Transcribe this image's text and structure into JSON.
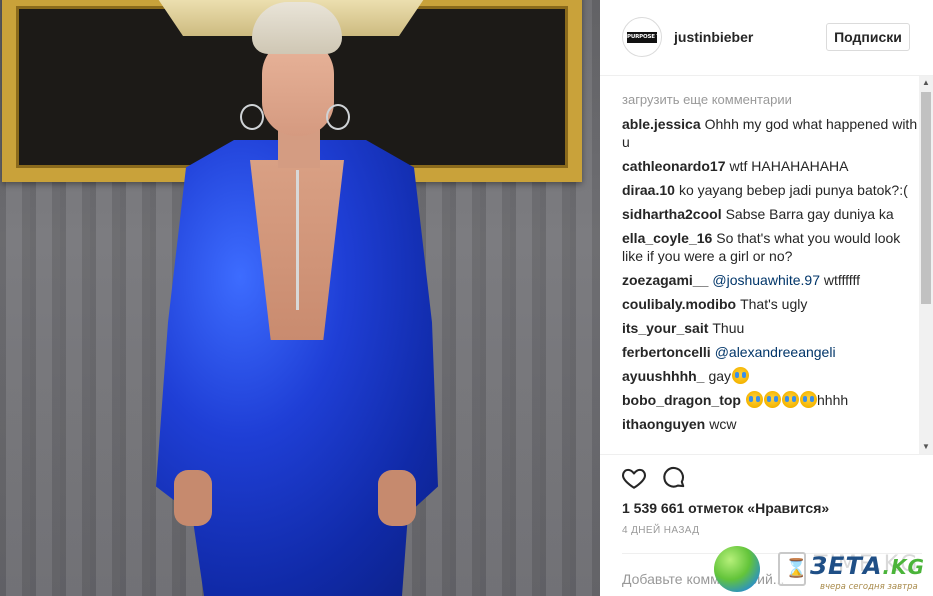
{
  "post": {
    "username": "justinbieber",
    "avatar_logo_text": "PURPOSE TOUR",
    "follow_label": "Подписки"
  },
  "comments": {
    "load_more": "загрузить еще комментарии",
    "items": [
      {
        "author": "able.jessica",
        "text": "Ohhh my god what happened with u"
      },
      {
        "author": "cathleonardo17",
        "text": "wtf HAHAHAHAHA"
      },
      {
        "author": "diraa.10",
        "text": "ko yayang bebep jadi punya batok?:("
      },
      {
        "author": "sidhartha2cool",
        "text": "Sabse Barra gay duniya ka"
      },
      {
        "author": "ella_coyle_16",
        "text": "So that's what you would look like if you were a girl or no?"
      },
      {
        "author": "zoezagami__",
        "mention": "@joshuawhite.97",
        "text": "wtffffff"
      },
      {
        "author": "coulibaly.modibo",
        "text": "That's ugly"
      },
      {
        "author": "its_your_sait",
        "text": "Thuu"
      },
      {
        "author": "ferbertoncelli",
        "mention": "@alexandreeangeli",
        "text": ""
      },
      {
        "author": "ayuushhhh_",
        "text": "gay"
      },
      {
        "author": "bobo_dragon_top",
        "text": "hhhh"
      },
      {
        "author": "ithaonguyen",
        "text": "wcw"
      }
    ]
  },
  "actions": {
    "likes": "1 539 661 отметок «Нравится»",
    "time": "4 дней назад",
    "add_comment_placeholder": "Добавьте комментарий..."
  },
  "watermark": {
    "brand": "ЗЕТА",
    "domain": ".KG",
    "faint": "TIME.KG",
    "tagline": "вчера сегодня завтра"
  },
  "icons": {
    "heart": "heart-icon",
    "comment": "comment-icon",
    "emoji": "tears-of-joy-emoji"
  },
  "colors": {
    "mention": "#003569",
    "muted": "#999999",
    "text": "#262626",
    "border": "#efefef"
  }
}
